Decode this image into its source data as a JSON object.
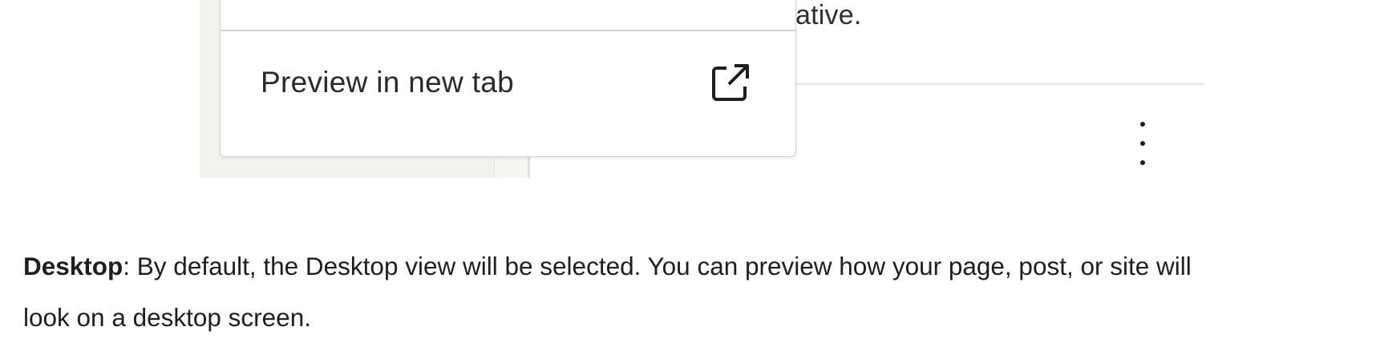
{
  "screenshot": {
    "background_text": "ative.",
    "popover": {
      "item_label": "Preview in new tab",
      "item_icon": "external-link-icon"
    },
    "more_options_icon": "vertical-ellipsis-icon"
  },
  "description": {
    "term": "Desktop",
    "text_line1": ": By default, the Desktop view will be selected. You can preview how your page, post, or site will",
    "text_line2": "look on a desktop screen."
  },
  "colors": {
    "panel_bg": "#f4f2ee",
    "text": "#1e1e1e",
    "border": "#cfcfcf"
  }
}
